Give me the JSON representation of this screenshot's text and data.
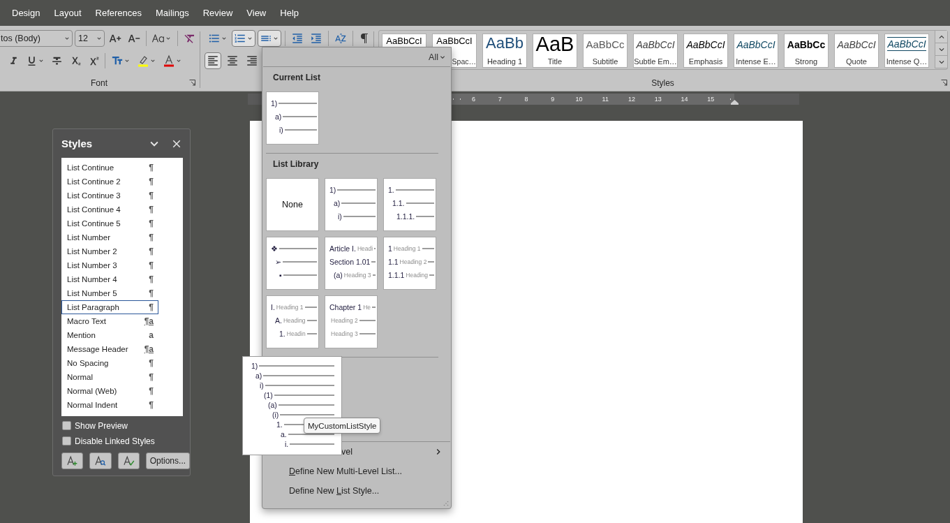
{
  "menu_tabs": [
    "Design",
    "Layout",
    "References",
    "Mailings",
    "Review",
    "View",
    "Help"
  ],
  "ribbon": {
    "font": {
      "font_name": "tos (Body)",
      "font_size": "12",
      "group_label": "Font"
    },
    "paragraph_buttons_top": [
      {
        "kind": "bullets",
        "pressed": false
      },
      {
        "kind": "numbering",
        "pressed": true
      },
      {
        "kind": "multilevel",
        "pressed": true
      },
      {
        "kind": "outdent",
        "pressed": false
      },
      {
        "kind": "indent",
        "pressed": false
      },
      {
        "kind": "sort",
        "pressed": false
      },
      {
        "kind": "pilcrow",
        "pressed": false
      }
    ],
    "paragraph_buttons_bottom": [
      {
        "kind": "align_left",
        "pressed": true
      },
      {
        "kind": "align_center",
        "pressed": false
      },
      {
        "kind": "align_right",
        "pressed": false
      }
    ],
    "styles_gallery": [
      {
        "kind": "normal",
        "preview": "AaBbCcI"
      },
      {
        "kind": "normal",
        "preview": "AaBbCcI",
        "label": "Spac…"
      },
      {
        "kind": "heading",
        "preview": "AaBb",
        "label": "Heading 1"
      },
      {
        "kind": "title",
        "preview": "AaB",
        "label": "Title"
      },
      {
        "kind": "subtitle",
        "preview": "AaBbCc",
        "label": "Subtitle"
      },
      {
        "kind": "subtle",
        "preview": "AaBbCcI",
        "label": "Subtle Em…"
      },
      {
        "kind": "emphasis",
        "preview": "AaBbCcI",
        "label": "Emphasis"
      },
      {
        "kind": "intense",
        "preview": "AaBbCcI",
        "label": "Intense E…"
      },
      {
        "kind": "strong",
        "preview": "AaBbCc",
        "label": "Strong"
      },
      {
        "kind": "quote",
        "preview": "AaBbCcI",
        "label": "Quote"
      },
      {
        "kind": "intense_quote",
        "preview": "AaBbCcI",
        "label": "Intense Q…"
      }
    ],
    "styles_group_label": "Styles"
  },
  "ruler": {
    "numbers": [
      "6",
      "7",
      "8",
      "9",
      "10",
      "11",
      "12",
      "13",
      "14",
      "15"
    ]
  },
  "styles_pane": {
    "title": "Styles",
    "items": [
      {
        "name": "List Continue",
        "kind": "paragraph",
        "marker": "¶",
        "selected": false
      },
      {
        "name": "List Continue 2",
        "kind": "paragraph",
        "marker": "¶",
        "selected": false
      },
      {
        "name": "List Continue 3",
        "kind": "paragraph",
        "marker": "¶",
        "selected": false
      },
      {
        "name": "List Continue 4",
        "kind": "paragraph",
        "marker": "¶",
        "selected": false
      },
      {
        "name": "List Continue 5",
        "kind": "paragraph",
        "marker": "¶",
        "selected": false
      },
      {
        "name": "List Number",
        "kind": "paragraph",
        "marker": "¶",
        "selected": false
      },
      {
        "name": "List Number 2",
        "kind": "paragraph",
        "marker": "¶",
        "selected": false
      },
      {
        "name": "List Number 3",
        "kind": "paragraph",
        "marker": "¶",
        "selected": false
      },
      {
        "name": "List Number 4",
        "kind": "paragraph",
        "marker": "¶",
        "selected": false
      },
      {
        "name": "List Number 5",
        "kind": "paragraph",
        "marker": "¶",
        "selected": false
      },
      {
        "name": "List Paragraph",
        "kind": "paragraph",
        "marker": "¶",
        "selected": true
      },
      {
        "name": "Macro Text",
        "kind": "linked",
        "marker": "¶a",
        "selected": false
      },
      {
        "name": "Mention",
        "kind": "character",
        "marker": "a",
        "selected": false
      },
      {
        "name": "Message Header",
        "kind": "linked",
        "marker": "¶a",
        "selected": false
      },
      {
        "name": "No Spacing",
        "kind": "paragraph",
        "marker": "¶",
        "selected": false
      },
      {
        "name": "Normal",
        "kind": "paragraph",
        "marker": "¶",
        "selected": false
      },
      {
        "name": "Normal (Web)",
        "kind": "paragraph",
        "marker": "¶",
        "selected": false
      },
      {
        "name": "Normal Indent",
        "kind": "paragraph",
        "marker": "¶",
        "selected": false
      }
    ],
    "options": [
      {
        "label": "Show Preview",
        "checked": false
      },
      {
        "label": "Disable Linked Styles",
        "checked": false
      }
    ],
    "options_button": "Options..."
  },
  "multilevel_menu": {
    "filter": "All",
    "current_list_heading": "Current List",
    "current_list": [
      {
        "marker": "1)",
        "children": [
          {
            "marker": "a)",
            "children": [
              {
                "marker": "i)"
              }
            ]
          }
        ]
      }
    ],
    "library_heading": "List Library",
    "library_rows": [
      [
        {
          "kind": "none",
          "label": "None"
        },
        {
          "kind": "levels",
          "rows": [
            {
              "marker": "1)",
              "children": [
                {
                  "marker": "a)",
                  "children": [
                    {
                      "marker": "i)"
                    }
                  ]
                }
              ]
            }
          ]
        },
        {
          "kind": "levels",
          "rows": [
            {
              "marker": "1.",
              "children": [
                {
                  "marker": "1.1.",
                  "children": [
                    {
                      "marker": "1.1.1."
                    }
                  ]
                }
              ]
            }
          ]
        }
      ],
      [
        {
          "kind": "levels",
          "rows": [
            {
              "marker": "❖",
              "children": [
                {
                  "marker": "➢",
                  "children": [
                    {
                      "marker": "▪"
                    }
                  ]
                }
              ]
            }
          ]
        },
        {
          "kind": "levels",
          "rows": [
            {
              "marker": "Article I.",
              "caption": "Headi"
            },
            {
              "marker": "Section 1.01",
              "children": [
                {
                  "marker": "(a)",
                  "caption": "Heading 3"
                }
              ]
            }
          ]
        },
        {
          "kind": "levels",
          "rows": [
            {
              "marker": "1",
              "caption": "Heading 1"
            },
            {
              "marker": "1.1",
              "caption": "Heading 2"
            },
            {
              "marker": "1.1.1",
              "caption": "Heading"
            }
          ]
        }
      ],
      [
        {
          "kind": "levels",
          "rows": [
            {
              "marker": "I.",
              "caption": "Heading 1",
              "children": [
                {
                  "marker": "A.",
                  "caption": "Heading",
                  "children": [
                    {
                      "marker": "1.",
                      "caption": "Headin"
                    }
                  ]
                }
              ]
            }
          ]
        },
        {
          "kind": "levels",
          "rows": [
            {
              "marker": "Chapter 1",
              "caption": "He"
            },
            {
              "caption": "Heading 2"
            },
            {
              "caption": "Heading 3"
            }
          ]
        }
      ]
    ],
    "menu_items": [
      {
        "kind": "submenu",
        "post": "vel"
      },
      {
        "kind": "command",
        "key": "D",
        "post": "efine New Multi-Level List..."
      },
      {
        "kind": "command",
        "pre": "Define New ",
        "key": "L",
        "post": "ist Style..."
      }
    ],
    "hover_preview": [
      {
        "marker": "1)",
        "children": [
          {
            "marker": "a)",
            "children": [
              {
                "marker": "i)",
                "children": [
                  {
                    "marker": "(1)",
                    "children": [
                      {
                        "marker": "(a)",
                        "children": [
                          {
                            "marker": "(i)",
                            "children": [
                              {
                                "marker": "1.",
                                "children": [
                                  {
                                    "marker": "a.",
                                    "children": [
                                      {
                                        "marker": "i."
                                      }
                                    ]
                                  }
                                ]
                              }
                            ]
                          }
                        ]
                      }
                    ]
                  }
                ]
              }
            ]
          }
        ]
      }
    ],
    "tooltip": "MyCustomListStyle"
  }
}
